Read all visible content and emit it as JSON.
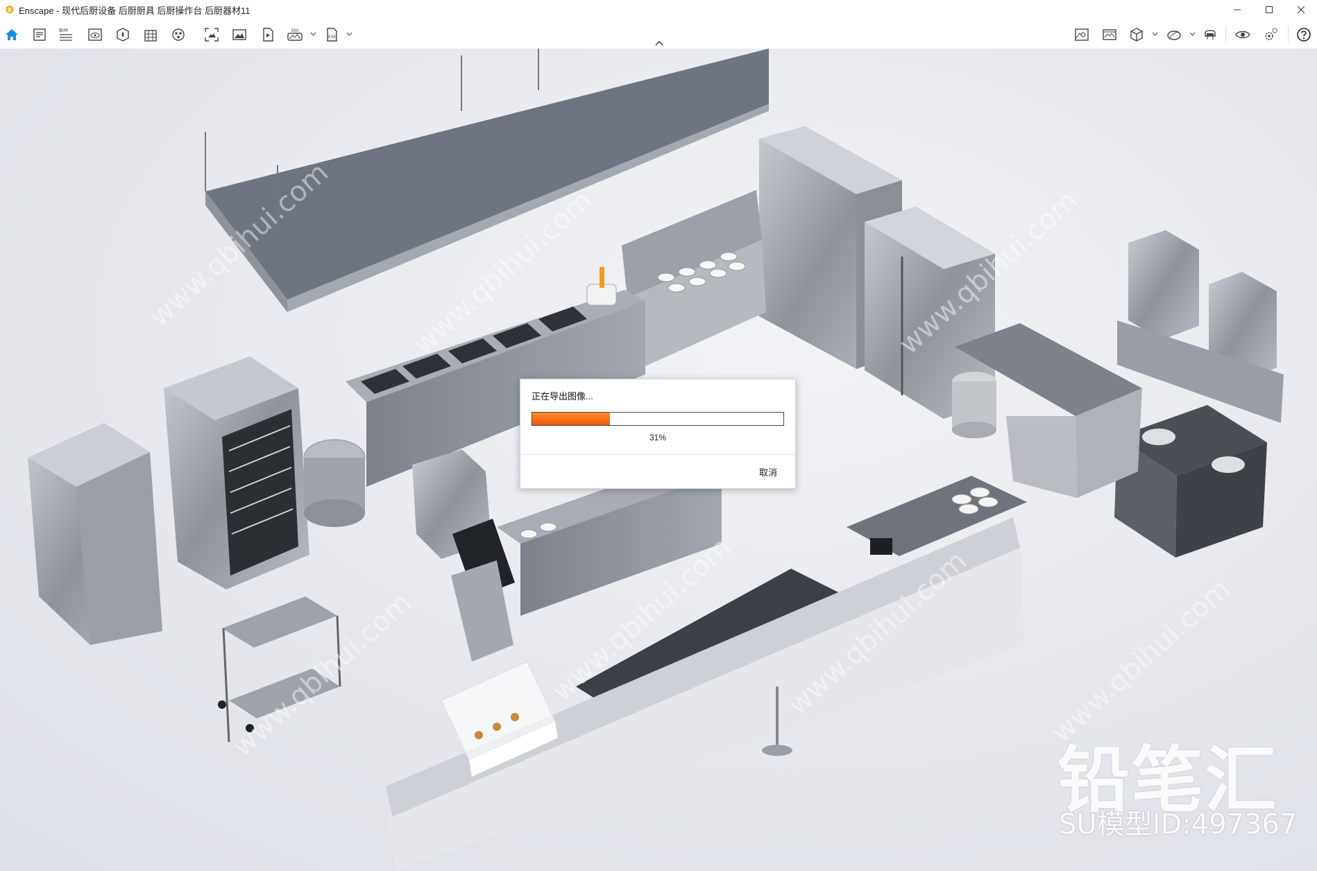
{
  "window": {
    "app_name": "Enscape",
    "title": "Enscape - 现代后厨设备 后厨厨具 后厨操作台 后厨器材11",
    "brand_color": "#f5a623",
    "controls": [
      "minimize",
      "maximize",
      "close"
    ]
  },
  "toolbar": {
    "left_tools": [
      {
        "icon": "home-icon",
        "active": true
      },
      {
        "icon": "notes-icon"
      },
      {
        "icon": "bim-icon",
        "label": "BIM"
      },
      {
        "icon": "view-icon"
      },
      {
        "icon": "asset-library-icon"
      },
      {
        "icon": "building-icon"
      },
      {
        "icon": "materials-icon"
      },
      {
        "icon": "screenshot-icon"
      },
      {
        "icon": "image-icon"
      },
      {
        "icon": "video-icon"
      },
      {
        "icon": "panorama-icon",
        "label": "360"
      },
      {
        "icon": "export-exe-icon",
        "label": "EXE"
      }
    ],
    "right_tools": [
      {
        "icon": "map-icon"
      },
      {
        "icon": "gallery-icon"
      },
      {
        "icon": "cube-icon"
      },
      {
        "icon": "sun-icon"
      },
      {
        "icon": "vr-headset-icon"
      },
      {
        "icon": "visual-settings-icon"
      },
      {
        "icon": "settings-icon"
      },
      {
        "icon": "help-icon"
      }
    ],
    "active_color": "#1d8fe1"
  },
  "dialog": {
    "title": "正在导出图像...",
    "progress_percent": 31,
    "progress_label": "31%",
    "cancel_label": "取消",
    "progress_color": "#f26a12"
  },
  "watermark": {
    "logo_text": "铅笔汇",
    "model_id": "SU模型ID:497367",
    "site": "www.qbihui.com"
  }
}
